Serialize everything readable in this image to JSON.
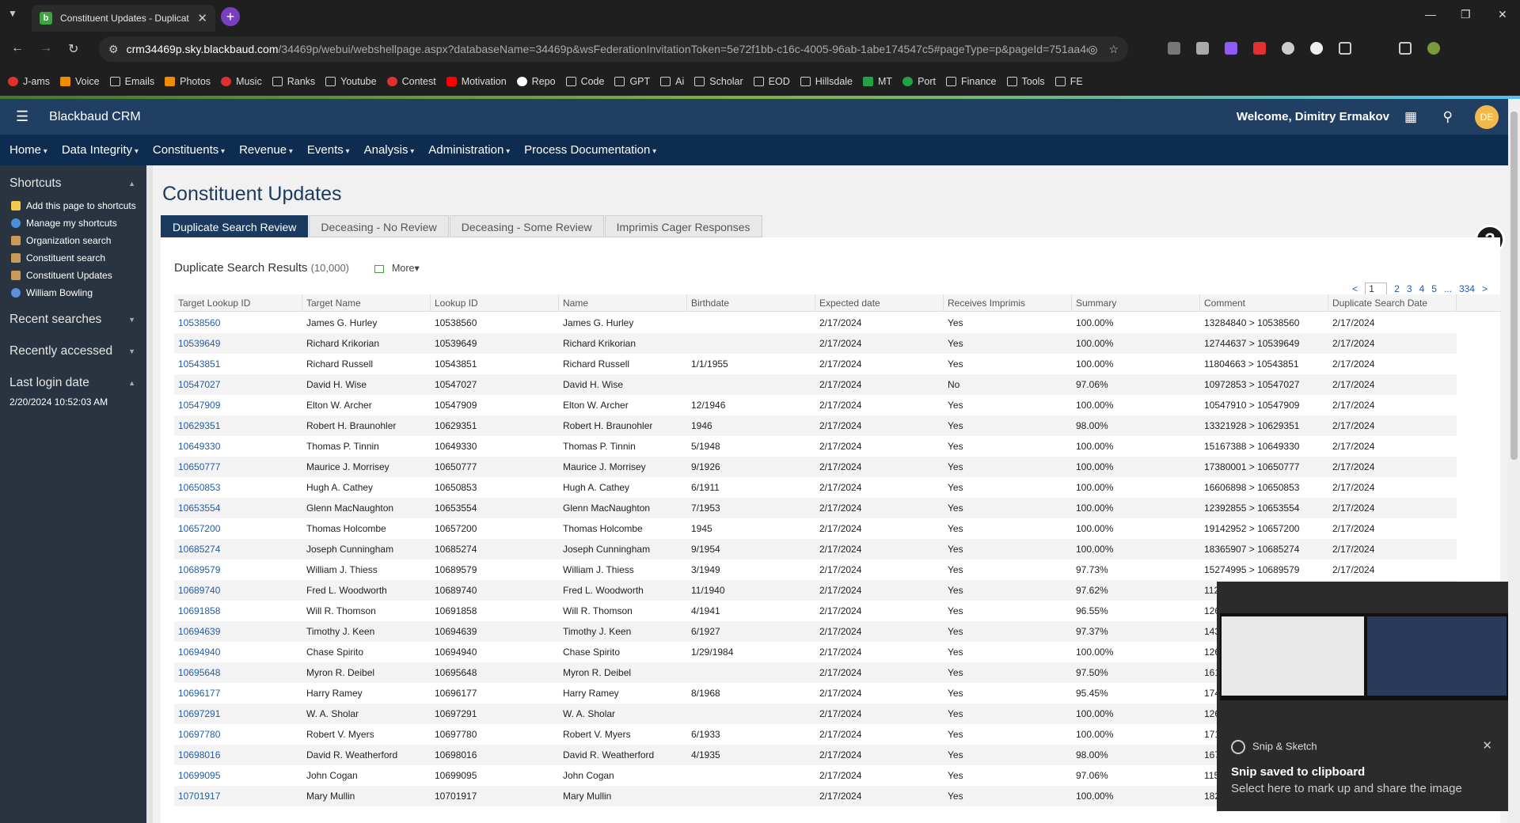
{
  "browser": {
    "tab_title": "Constituent Updates - Duplicat",
    "url_host": "crm34469p.sky.blackbaud.com",
    "url_path": "/34469p/webui/webshellpage.aspx?databaseName=34469p&wsFederationInvitationToken=5e72f1bb-c16c-4005-96ab-1abe174547c5#pageType=p&pageId=751aa4e...",
    "bookmarks": [
      "J-ams",
      "Voice",
      "Emails",
      "Photos",
      "Music",
      "Ranks",
      "Youtube",
      "Contest",
      "Motivation",
      "Repo",
      "Code",
      "GPT",
      "Ai",
      "Scholar",
      "EOD",
      "Hillsdale",
      "MT",
      "Port",
      "Finance",
      "Tools",
      "FE"
    ]
  },
  "header": {
    "brand": "Blackbaud CRM",
    "welcome": "Welcome, Dimitry Ermakov",
    "avatar_initials": "DE"
  },
  "nav": [
    "Home",
    "Data Integrity",
    "Constituents",
    "Revenue",
    "Events",
    "Analysis",
    "Administration",
    "Process Documentation"
  ],
  "sidebar": {
    "shortcuts_title": "Shortcuts",
    "shortcuts": [
      "Add this page to shortcuts",
      "Manage my shortcuts",
      "Organization search",
      "Constituent search",
      "Constituent Updates",
      "William Bowling"
    ],
    "recent_searches": "Recent searches",
    "recently_accessed": "Recently accessed",
    "last_login_title": "Last login date",
    "last_login_value": "2/20/2024 10:52:03 AM"
  },
  "page": {
    "title": "Constituent Updates",
    "tabs": [
      "Duplicate Search Review",
      "Deceasing - No Review",
      "Deceasing - Some Review",
      "Imprimis Cager Responses"
    ],
    "results_title": "Duplicate Search Results",
    "results_count": "(10,000)",
    "more": "More",
    "pager": {
      "prev": "<",
      "current": "1",
      "pages": [
        "2",
        "3",
        "4",
        "5"
      ],
      "ellipsis": "...",
      "last": "334",
      "next": ">"
    }
  },
  "grid": {
    "columns": [
      "Target Lookup ID",
      "Target Name",
      "Lookup ID",
      "Name",
      "Birthdate",
      "Expected date",
      "Receives Imprimis",
      "Summary",
      "Comment",
      "Duplicate Search Date"
    ],
    "rows": [
      [
        "10538560",
        "James G. Hurley",
        "10538560",
        "James G. Hurley",
        "",
        "2/17/2024",
        "Yes",
        "100.00%",
        "13284840 > 10538560",
        "2/17/2024"
      ],
      [
        "10539649",
        "Richard Krikorian",
        "10539649",
        "Richard Krikorian",
        "",
        "2/17/2024",
        "Yes",
        "100.00%",
        "12744637 > 10539649",
        "2/17/2024"
      ],
      [
        "10543851",
        "Richard Russell",
        "10543851",
        "Richard Russell",
        "1/1/1955",
        "2/17/2024",
        "Yes",
        "100.00%",
        "11804663 > 10543851",
        "2/17/2024"
      ],
      [
        "10547027",
        "David H. Wise",
        "10547027",
        "David H. Wise",
        "",
        "2/17/2024",
        "No",
        "97.06%",
        "10972853 > 10547027",
        "2/17/2024"
      ],
      [
        "10547909",
        "Elton W. Archer",
        "10547909",
        "Elton W. Archer",
        "12/1946",
        "2/17/2024",
        "Yes",
        "100.00%",
        "10547910 > 10547909",
        "2/17/2024"
      ],
      [
        "10629351",
        "Robert H. Braunohler",
        "10629351",
        "Robert H. Braunohler",
        "1946",
        "2/17/2024",
        "Yes",
        "98.00%",
        "13321928 > 10629351",
        "2/17/2024"
      ],
      [
        "10649330",
        "Thomas P. Tinnin",
        "10649330",
        "Thomas P. Tinnin",
        "5/1948",
        "2/17/2024",
        "Yes",
        "100.00%",
        "15167388 > 10649330",
        "2/17/2024"
      ],
      [
        "10650777",
        "Maurice J. Morrisey",
        "10650777",
        "Maurice J. Morrisey",
        "9/1926",
        "2/17/2024",
        "Yes",
        "100.00%",
        "17380001 > 10650777",
        "2/17/2024"
      ],
      [
        "10650853",
        "Hugh A. Cathey",
        "10650853",
        "Hugh A. Cathey",
        "6/1911",
        "2/17/2024",
        "Yes",
        "100.00%",
        "16606898 > 10650853",
        "2/17/2024"
      ],
      [
        "10653554",
        "Glenn MacNaughton",
        "10653554",
        "Glenn MacNaughton",
        "7/1953",
        "2/17/2024",
        "Yes",
        "100.00%",
        "12392855 > 10653554",
        "2/17/2024"
      ],
      [
        "10657200",
        "Thomas Holcombe",
        "10657200",
        "Thomas Holcombe",
        "1945",
        "2/17/2024",
        "Yes",
        "100.00%",
        "19142952 > 10657200",
        "2/17/2024"
      ],
      [
        "10685274",
        "Joseph Cunningham",
        "10685274",
        "Joseph Cunningham",
        "9/1954",
        "2/17/2024",
        "Yes",
        "100.00%",
        "18365907 > 10685274",
        "2/17/2024"
      ],
      [
        "10689579",
        "William J. Thiess",
        "10689579",
        "William J. Thiess",
        "3/1949",
        "2/17/2024",
        "Yes",
        "97.73%",
        "15274995 > 10689579",
        "2/17/2024"
      ],
      [
        "10689740",
        "Fred L. Woodworth",
        "10689740",
        "Fred L. Woodworth",
        "11/1940",
        "2/17/2024",
        "Yes",
        "97.62%",
        "112",
        "2/17/2024"
      ],
      [
        "10691858",
        "Will R. Thomson",
        "10691858",
        "Will R. Thomson",
        "4/1941",
        "2/17/2024",
        "Yes",
        "96.55%",
        "126",
        "2/17/2024"
      ],
      [
        "10694639",
        "Timothy J. Keen",
        "10694639",
        "Timothy J. Keen",
        "6/1927",
        "2/17/2024",
        "Yes",
        "97.37%",
        "143",
        "2/17/2024"
      ],
      [
        "10694940",
        "Chase Spirito",
        "10694940",
        "Chase Spirito",
        "1/29/1984",
        "2/17/2024",
        "Yes",
        "100.00%",
        "126",
        "2/17/2024"
      ],
      [
        "10695648",
        "Myron R. Deibel",
        "10695648",
        "Myron R. Deibel",
        "",
        "2/17/2024",
        "Yes",
        "97.50%",
        "161",
        "2/17/2024"
      ],
      [
        "10696177",
        "Harry Ramey",
        "10696177",
        "Harry Ramey",
        "8/1968",
        "2/17/2024",
        "Yes",
        "95.45%",
        "174",
        "2/17/2024"
      ],
      [
        "10697291",
        "W. A. Sholar",
        "10697291",
        "W. A. Sholar",
        "",
        "2/17/2024",
        "Yes",
        "100.00%",
        "126",
        "2/17/2024"
      ],
      [
        "10697780",
        "Robert V. Myers",
        "10697780",
        "Robert V. Myers",
        "6/1933",
        "2/17/2024",
        "Yes",
        "100.00%",
        "171",
        "2/17/2024"
      ],
      [
        "10698016",
        "David R. Weatherford",
        "10698016",
        "David R. Weatherford",
        "4/1935",
        "2/17/2024",
        "Yes",
        "98.00%",
        "167",
        "2/17/2024"
      ],
      [
        "10699095",
        "John Cogan",
        "10699095",
        "John Cogan",
        "",
        "2/17/2024",
        "Yes",
        "97.06%",
        "115",
        "2/17/2024"
      ],
      [
        "10701917",
        "Mary Mullin",
        "10701917",
        "Mary Mullin",
        "",
        "2/17/2024",
        "Yes",
        "100.00%",
        "182",
        "2/17/2024"
      ]
    ]
  },
  "toast": {
    "app": "Snip & Sketch",
    "title": "Snip saved to clipboard",
    "body": "Select here to mark up and share the image"
  }
}
